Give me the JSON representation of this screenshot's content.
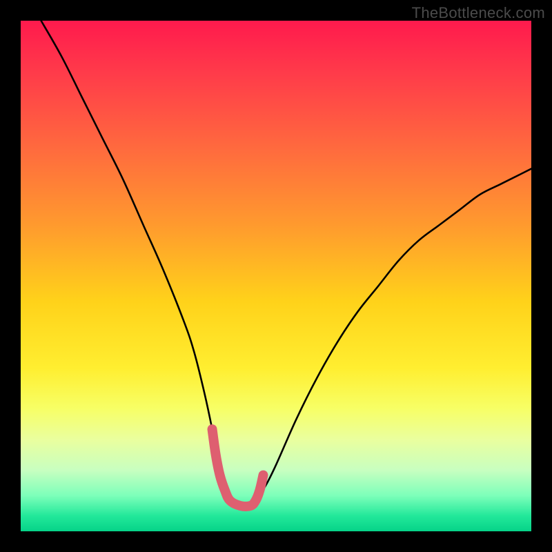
{
  "watermark": "TheBottleneck.com",
  "chart_data": {
    "type": "line",
    "title": "",
    "xlabel": "",
    "ylabel": "",
    "xlim": [
      0,
      100
    ],
    "ylim": [
      0,
      100
    ],
    "grid": false,
    "legend": false,
    "series": [
      {
        "name": "bottleneck-curve",
        "color": "#000000",
        "x": [
          4,
          8,
          12,
          16,
          20,
          24,
          28,
          32,
          34,
          36,
          37.5,
          39,
          40,
          41,
          43,
          44,
          45,
          46,
          48,
          50,
          54,
          58,
          62,
          66,
          70,
          74,
          78,
          82,
          86,
          90,
          94,
          98,
          100
        ],
        "y": [
          100,
          93,
          85,
          77,
          69,
          60,
          51,
          41,
          35,
          27,
          20,
          12,
          8,
          6,
          5,
          5,
          5,
          6,
          9,
          13,
          22,
          30,
          37,
          43,
          48,
          53,
          57,
          60,
          63,
          66,
          68,
          70,
          71
        ]
      },
      {
        "name": "optimal-zone-marker",
        "color": "#e06070",
        "x": [
          37.5,
          38.2,
          39,
          40,
          41,
          43,
          45,
          46,
          46.8,
          47.5
        ],
        "y": [
          20,
          15,
          11,
          8,
          6,
          5,
          5,
          6,
          8,
          11
        ]
      }
    ],
    "background_gradient": {
      "top": "#ff1a4d",
      "mid": "#ffee30",
      "bottom": "#06d388"
    }
  }
}
